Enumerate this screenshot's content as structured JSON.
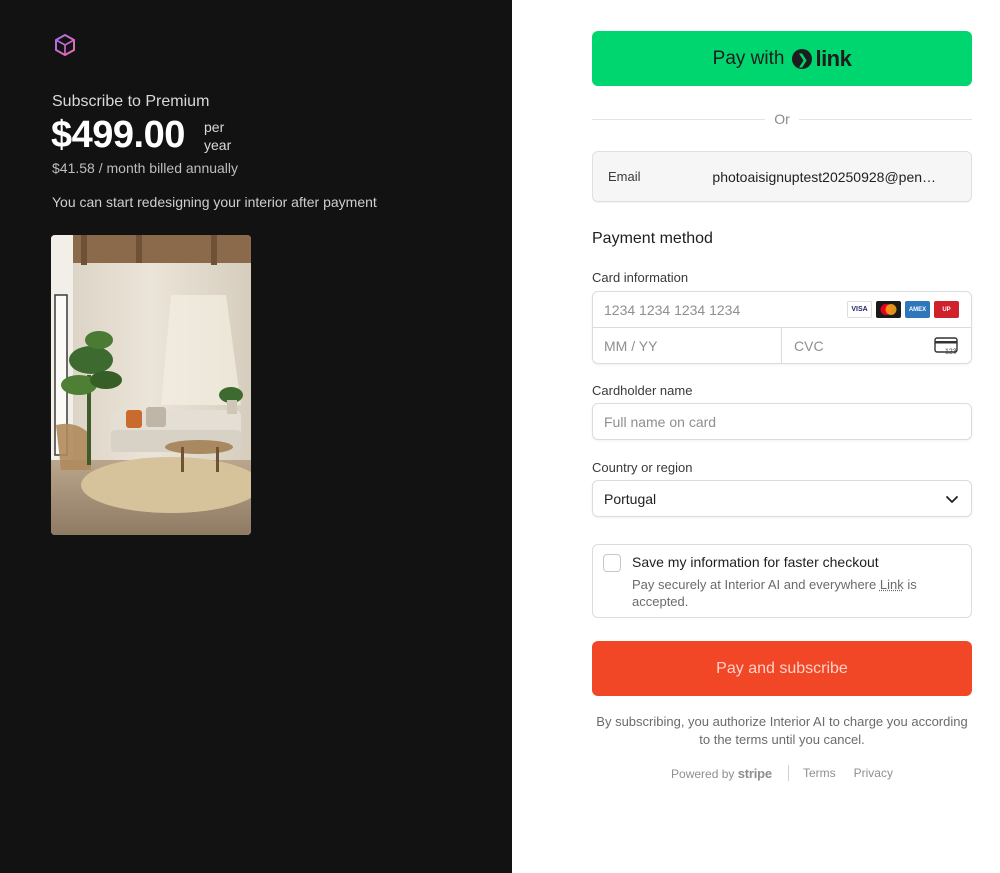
{
  "summary": {
    "subscribe_title": "Subscribe to Premium",
    "price": "$499.00",
    "period": "per year",
    "monthly_note": "$41.58 / month billed annually",
    "info": "You can start redesigning your interior after payment"
  },
  "checkout": {
    "link_button_prefix": "Pay with",
    "link_brand": "link",
    "or_text": "Or",
    "email_label": "Email",
    "email_value": "photoaisignuptest20250928@pen…",
    "payment_method_title": "Payment method",
    "card_info_label": "Card information",
    "card_number_placeholder": "1234 1234 1234 1234",
    "expiry_placeholder": "MM / YY",
    "cvc_placeholder": "CVC",
    "cardholder_label": "Cardholder name",
    "cardholder_placeholder": "Full name on card",
    "country_label": "Country or region",
    "country_value": "Portugal",
    "save_title": "Save my information for faster checkout",
    "save_desc_before": "Pay securely at Interior AI and everywhere ",
    "save_desc_link": "Link",
    "save_desc_after": " is accepted.",
    "pay_button": "Pay and subscribe",
    "terms_text": "By subscribing, you authorize Interior AI to charge you according to the terms until you cancel.",
    "powered_by": "Powered by",
    "stripe": "stripe",
    "terms_link": "Terms",
    "privacy_link": "Privacy"
  },
  "card_brands": [
    "VISA",
    "Mastercard",
    "AMEX",
    "UnionPay"
  ],
  "colors": {
    "left_bg": "#121212",
    "link_green": "#00d66f",
    "pay_button": "#f24726"
  }
}
